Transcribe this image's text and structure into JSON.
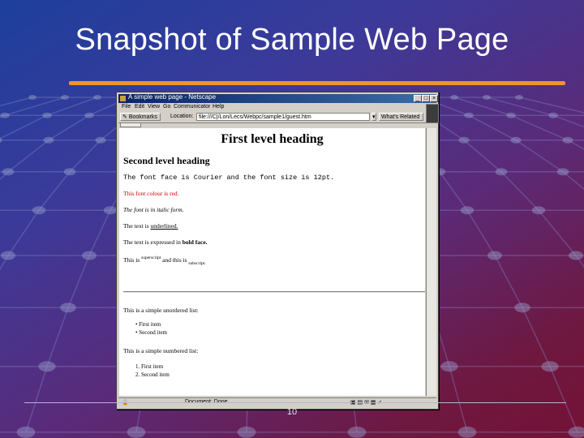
{
  "slide": {
    "title": "Snapshot of Sample Web Page",
    "page_number": "10",
    "accent_color": "#f0922e"
  },
  "window": {
    "title": "A simple web page - Netscape",
    "controls": [
      "_",
      "□",
      "×"
    ],
    "menu": [
      "File",
      "Edit",
      "View",
      "Go",
      "Communicator",
      "Help"
    ],
    "toolbar": {
      "bookmarks_label": "Bookmarks",
      "location_label": "Location:",
      "url": "file:///C|/Lon/Lecs/Webpc/sample1/guest.htm",
      "whats_related_label": "What's Related"
    },
    "status": {
      "text": "Document: Done"
    }
  },
  "page": {
    "h1": "First level heading",
    "h2": "Second level heading",
    "courier_text": "The font face is Courier and the font size is 12pt.",
    "red_text": "This font colour is red.",
    "italic_text": "The font is in italic form.",
    "underline_text_prefix": "The text is ",
    "underline_text_suffix": "underlined.",
    "bold_text_prefix": "The text is expressed in ",
    "bold_text_suffix": "bold face.",
    "script_prefix": "This is ",
    "superscript": "superscript",
    "script_middle": " and this is ",
    "subscript": "subscript.",
    "unordered_intro": "This is a simple unordered list:",
    "unordered_items": [
      "First item",
      "Second item"
    ],
    "ordered_intro": "This is a simple numbered list:",
    "ordered_items": [
      "1. First item",
      "2. Second item"
    ]
  }
}
